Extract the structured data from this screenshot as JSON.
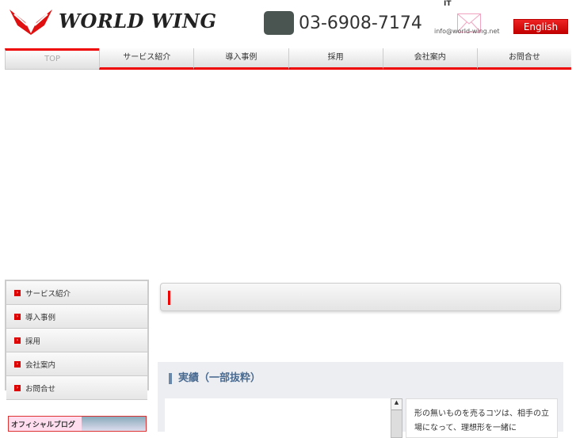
{
  "header": {
    "logo": "WORLD WING",
    "phone": "03-6908-7174",
    "it": "IT",
    "email": "info@world-wing.net",
    "english": "English"
  },
  "nav": [
    "TOP",
    "サービス紹介",
    "導入事例",
    "採用",
    "会社案内",
    "お問合せ"
  ],
  "sidebar": [
    "サービス紹介",
    "導入事例",
    "採用",
    "会社案内",
    "お問合せ"
  ],
  "blog": "オフィシャルブログ",
  "results": {
    "title": "実績（一部抜粋）",
    "text": "形の無いものを売るコツは、相手の立場になって、理想形を一緒に"
  }
}
